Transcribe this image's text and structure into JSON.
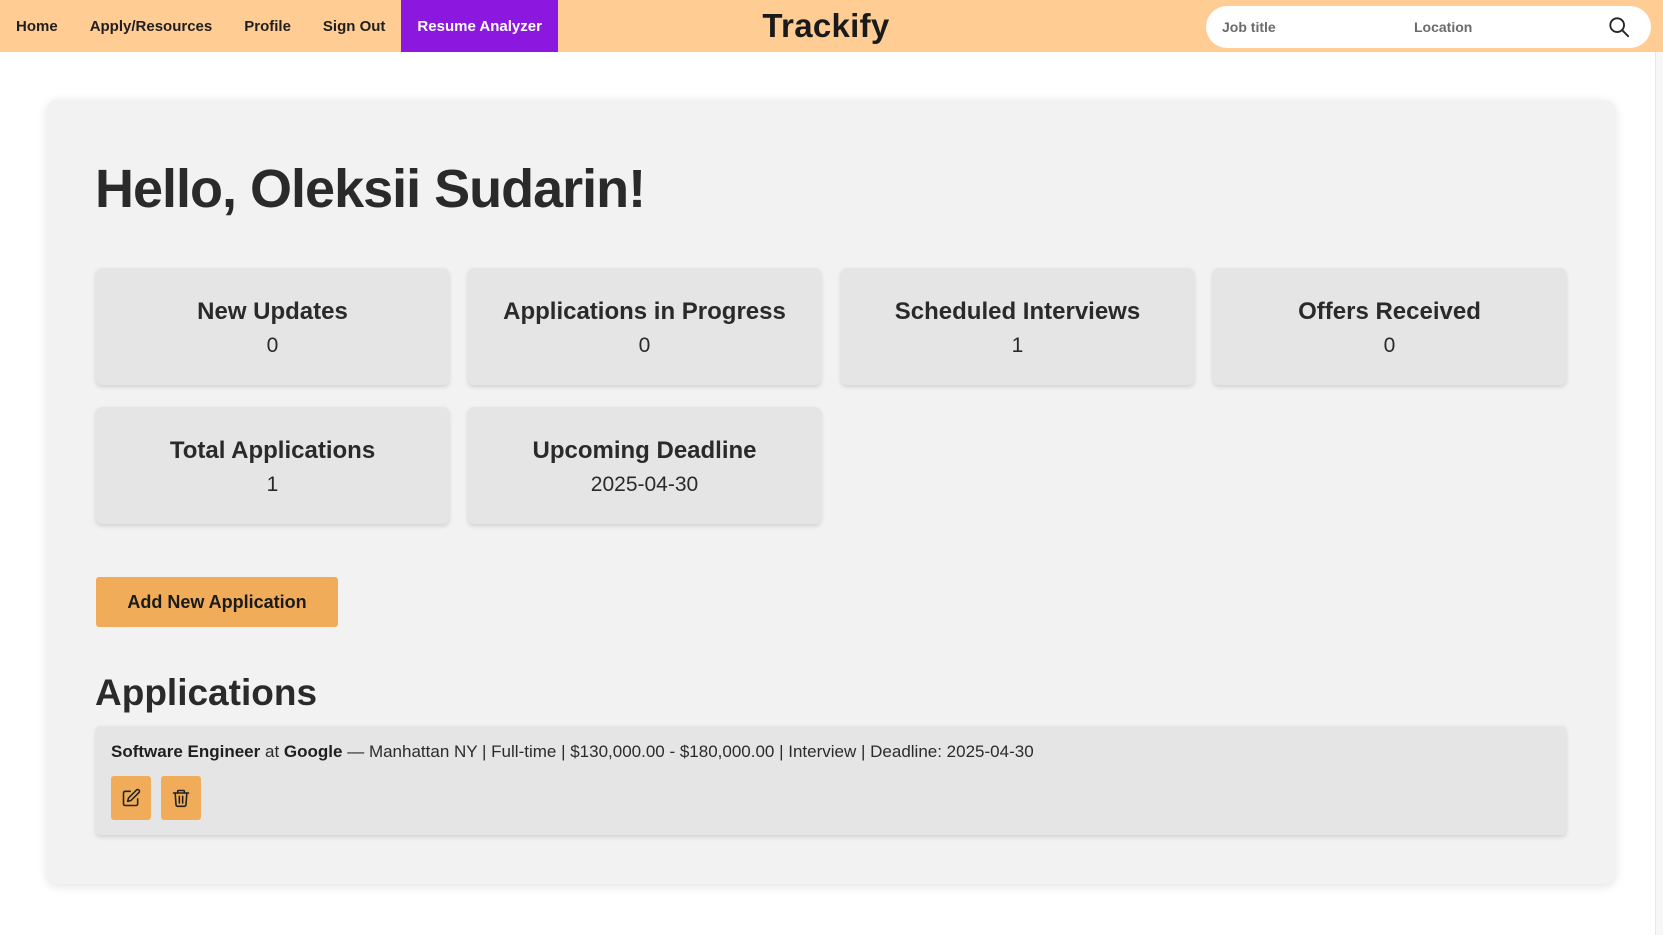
{
  "nav": {
    "items": [
      {
        "label": "Home"
      },
      {
        "label": "Apply/Resources"
      },
      {
        "label": "Profile"
      },
      {
        "label": "Sign Out"
      },
      {
        "label": "Resume Analyzer",
        "active": true
      }
    ]
  },
  "brand": "Trackify",
  "search": {
    "job_placeholder": "Job title",
    "location_placeholder": "Location",
    "icon": "search-icon"
  },
  "greeting": "Hello, Oleksii Sudarin!",
  "stats": [
    {
      "title": "New Updates",
      "value": "0"
    },
    {
      "title": "Applications in Progress",
      "value": "0"
    },
    {
      "title": "Scheduled Interviews",
      "value": "1"
    },
    {
      "title": "Offers Received",
      "value": "0"
    },
    {
      "title": "Total Applications",
      "value": "1"
    },
    {
      "title": "Upcoming Deadline",
      "value": "2025-04-30"
    }
  ],
  "add_button": "Add New Application",
  "applications_heading": "Applications",
  "applications": [
    {
      "title": "Software Engineer",
      "at": "at",
      "company": "Google",
      "details": "— Manhattan NY | Full-time | $130,000.00 - $180,000.00 | Interview | Deadline: 2025-04-30",
      "edit_icon": "edit-icon",
      "delete_icon": "trash-icon"
    }
  ],
  "colors": {
    "topbar": "#ffcc94",
    "active_nav": "#8c18e0",
    "accent_button": "#f0ac58",
    "panel": "#f2f2f2",
    "card": "#e5e5e5"
  }
}
